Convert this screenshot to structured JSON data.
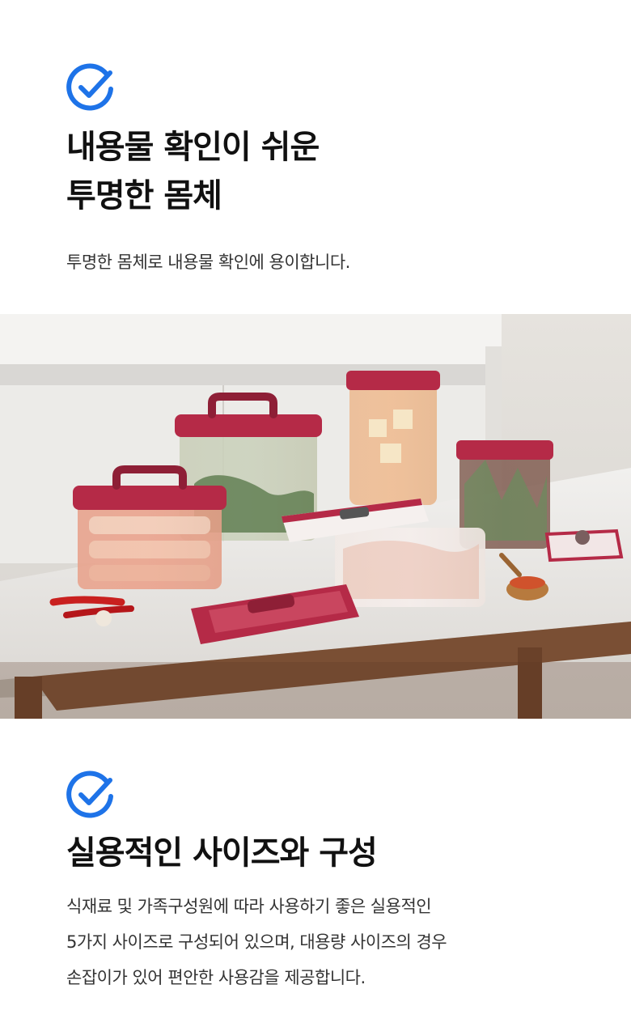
{
  "section1": {
    "icon": "check-circle-icon",
    "title_lines": [
      "내용물 확인이 쉬운",
      "투명한 몸체"
    ],
    "description": "투명한 몸체로 내용물 확인에 용이합니다."
  },
  "photo": {
    "icon": "product-photo-illustration"
  },
  "section2": {
    "icon": "check-circle-icon",
    "title": "실용적인 사이즈와 구성",
    "description_lines": [
      "식재료 및 가족구성원에 따라 사용하기 좋은 실용적인",
      "5가지 사이즈로 구성되어 있으며, 대용량 사이즈의 경우",
      "손잡이가 있어 편안한 사용감을 제공합니다."
    ]
  },
  "colors": {
    "accent": "#1e73e8",
    "lid": "#b52a47",
    "text": "#111111"
  }
}
